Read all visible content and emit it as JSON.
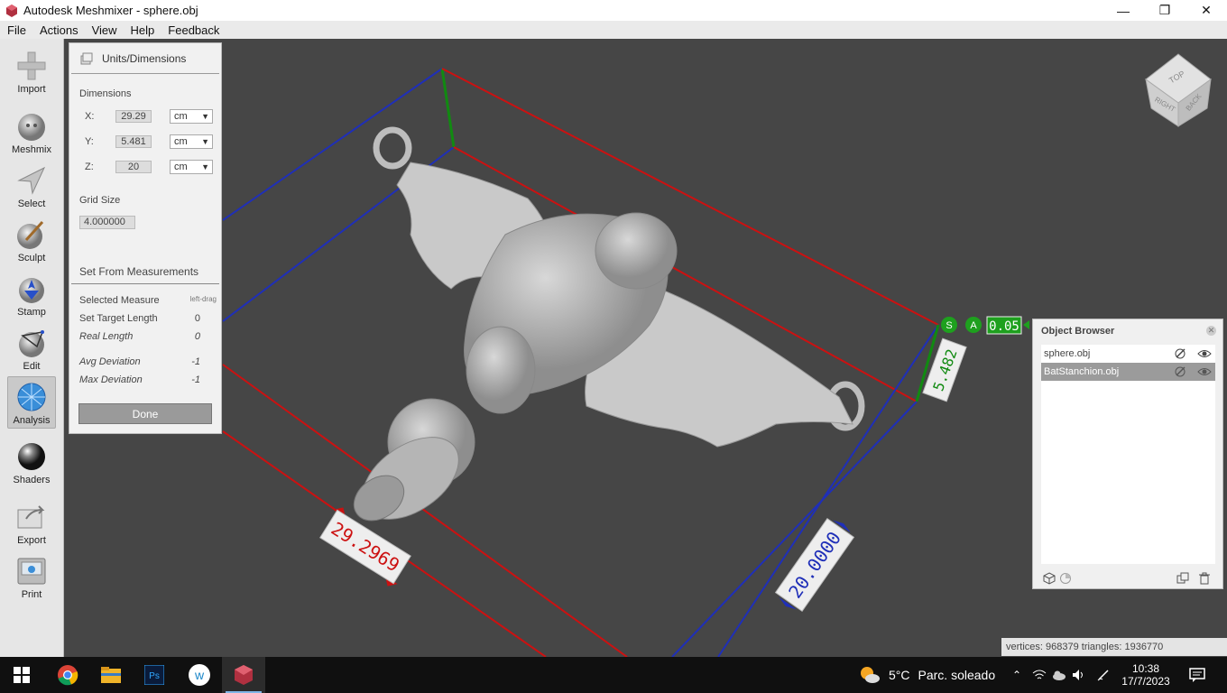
{
  "window": {
    "title": "Autodesk Meshmixer - sphere.obj",
    "minimize": "—",
    "maximize": "❐",
    "close": "✕"
  },
  "menu": [
    "File",
    "Actions",
    "View",
    "Help",
    "Feedback"
  ],
  "tools": [
    {
      "label": "Import",
      "icon": "plus-icon"
    },
    {
      "label": "Meshmix",
      "icon": "bunny-ball-icon"
    },
    {
      "label": "Select",
      "icon": "arrow-icon"
    },
    {
      "label": "Sculpt",
      "icon": "brush-icon"
    },
    {
      "label": "Stamp",
      "icon": "stamp-icon"
    },
    {
      "label": "Edit",
      "icon": "edit-sphere-icon"
    },
    {
      "label": "Analysis",
      "icon": "analysis-globe-icon"
    },
    {
      "label": "Shaders",
      "icon": "shader-sphere-icon"
    },
    {
      "label": "Export",
      "icon": "export-icon"
    },
    {
      "label": "Print",
      "icon": "printer-icon"
    }
  ],
  "panel": {
    "title": "Units/Dimensions",
    "dimensions_label": "Dimensions",
    "x_label": "X:",
    "x_value": "29.29",
    "y_label": "Y:",
    "y_value": "5.481",
    "z_label": "Z:",
    "z_value": "20",
    "unit": "cm",
    "grid_label": "Grid Size",
    "grid_value": "4.000000",
    "measure_title": "Set From Measurements",
    "selected_measure_label": "Selected Measure",
    "selected_measure_value": "left-drag",
    "target_length_label": "Set Target Length",
    "target_length_value": "0",
    "real_length_label": "Real Length",
    "real_length_value": "0",
    "avg_dev_label": "Avg Deviation",
    "avg_dev_value": "-1",
    "max_dev_label": "Max Deviation",
    "max_dev_value": "-1",
    "done_label": "Done"
  },
  "viewport": {
    "label_x": "29.2969",
    "label_z": "20.0000",
    "label_y": "5.482",
    "snap_s": "S",
    "snap_a": "A",
    "snap_value": "0.05",
    "cube_top": "TOP",
    "cube_right": "RIGHT",
    "cube_back": "BACK"
  },
  "object_browser": {
    "title": "Object Browser",
    "items": [
      {
        "name": "sphere.obj",
        "selected": false
      },
      {
        "name": "BatStanchion.obj",
        "selected": true
      }
    ]
  },
  "status": "vertices: 968379 triangles: 1936770",
  "taskbar": {
    "weather_temp": "5°C",
    "weather_text": "Parc. soleado",
    "time": "10:38",
    "date": "17/7/2023"
  },
  "colors": {
    "axis_x": "#cc1111",
    "axis_z": "#1f2fb8",
    "axis_y": "#118a11",
    "viewport_bg": "#464646"
  }
}
